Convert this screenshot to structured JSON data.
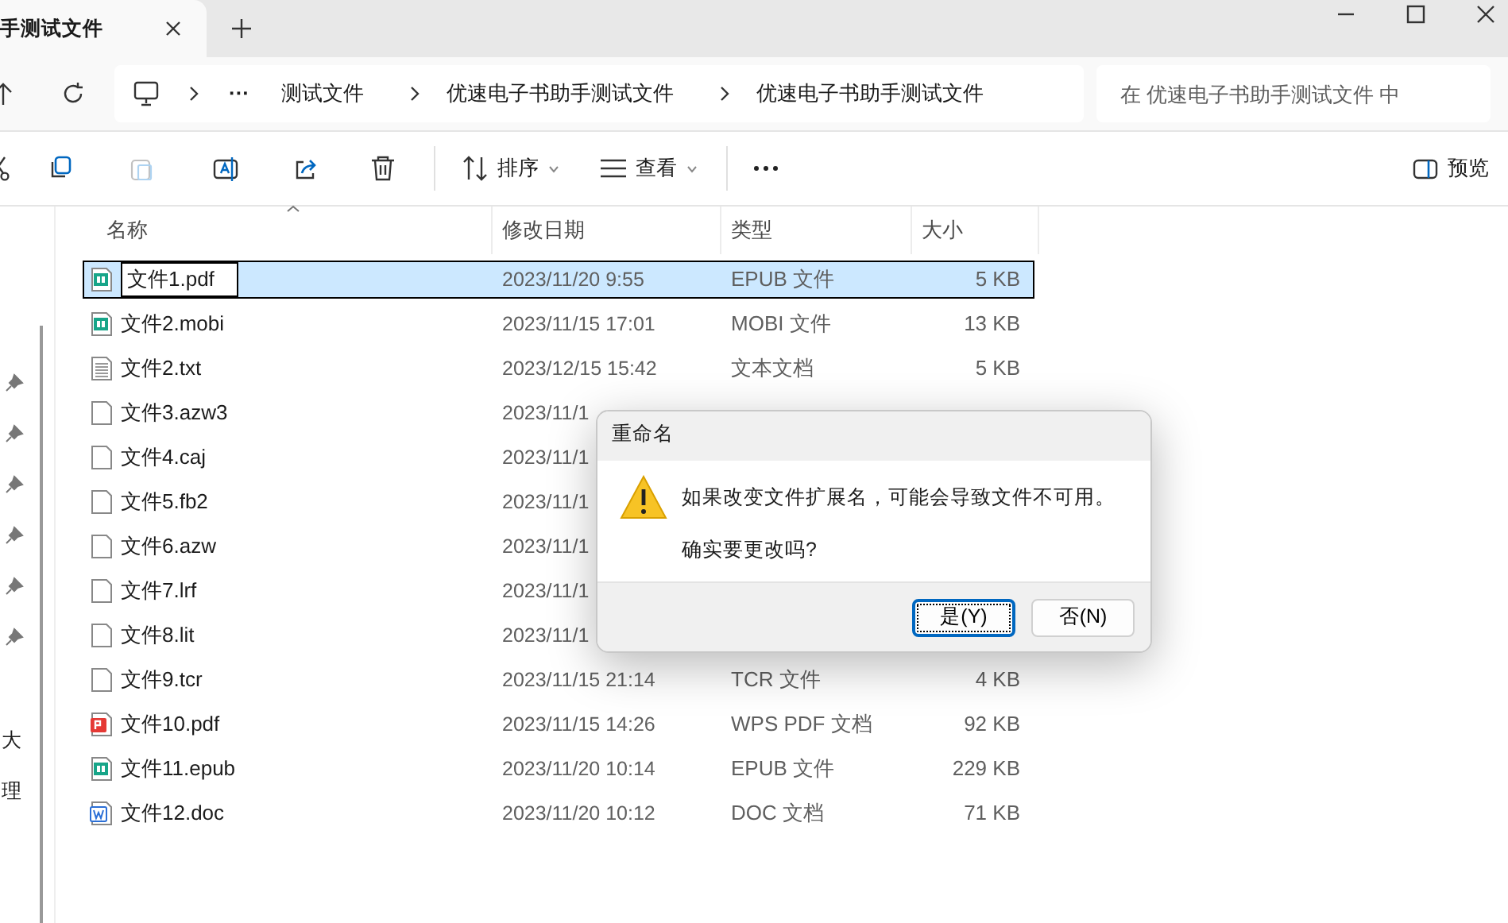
{
  "tab": {
    "title": "手测试文件"
  },
  "address": {
    "overflow": "···",
    "crumbs": [
      "测试文件",
      "优速电子书助手测试文件",
      "优速电子书助手测试文件"
    ]
  },
  "search": {
    "placeholder": "在 优速电子书助手测试文件 中"
  },
  "toolbar": [
    {
      "kind": "cut",
      "disabled": false
    },
    {
      "kind": "copy",
      "disabled": false
    },
    {
      "kind": "paste",
      "disabled": true
    },
    {
      "kind": "rename",
      "disabled": false
    },
    {
      "kind": "share",
      "disabled": false
    },
    {
      "kind": "delete",
      "disabled": false
    },
    {
      "kind": "sort",
      "label": "排序"
    },
    {
      "kind": "view",
      "label": "查看"
    },
    {
      "kind": "more"
    }
  ],
  "preview": {
    "label": "预览"
  },
  "sidebar": {
    "items": [
      {
        "pinned": true
      },
      {
        "pinned": true
      },
      {
        "pinned": true
      },
      {
        "pinned": true
      },
      {
        "pinned": true
      },
      {
        "pinned": true
      },
      {
        "label": "大"
      },
      {
        "label": "理"
      }
    ]
  },
  "table": {
    "columns": [
      "名称",
      "修改日期",
      "类型",
      "大小"
    ],
    "rows": [
      {
        "kind": "epub",
        "name": "文件1.pdf",
        "date": "2023/11/20 9:55",
        "type": "EPUB 文件",
        "size": "5 KB",
        "selected": true,
        "editing": true
      },
      {
        "kind": "epub",
        "name": "文件2.mobi",
        "date": "2023/11/15 17:01",
        "type": "MOBI 文件",
        "size": "13 KB",
        "selected": false,
        "editing": false
      },
      {
        "kind": "text",
        "name": "文件2.txt",
        "date": "2023/12/15 15:42",
        "type": "文本文档",
        "size": "5 KB",
        "selected": false,
        "editing": false
      },
      {
        "kind": "blank",
        "name": "文件3.azw3",
        "date": "2023/11/1",
        "selected": false,
        "editing": false
      },
      {
        "kind": "blank",
        "name": "文件4.caj",
        "date": "2023/11/1",
        "selected": false,
        "editing": false
      },
      {
        "kind": "blank",
        "name": "文件5.fb2",
        "date": "2023/11/1",
        "selected": false,
        "editing": false
      },
      {
        "kind": "blank",
        "name": "文件6.azw",
        "date": "2023/11/1",
        "selected": false,
        "editing": false
      },
      {
        "kind": "blank",
        "name": "文件7.lrf",
        "date": "2023/11/1",
        "selected": false,
        "editing": false
      },
      {
        "kind": "blank",
        "name": "文件8.lit",
        "date": "2023/11/1",
        "selected": false,
        "editing": false
      },
      {
        "kind": "blank",
        "name": "文件9.tcr",
        "date": "2023/11/15 21:14",
        "type": "TCR 文件",
        "size": "4 KB",
        "selected": false,
        "editing": false
      },
      {
        "kind": "pdf",
        "name": "文件10.pdf",
        "date": "2023/11/15 14:26",
        "type": "WPS PDF 文档",
        "size": "92 KB",
        "selected": false,
        "editing": false
      },
      {
        "kind": "epub",
        "name": "文件11.epub",
        "date": "2023/11/20 10:14",
        "type": "EPUB 文件",
        "size": "229 KB",
        "selected": false,
        "editing": false
      },
      {
        "kind": "doc",
        "name": "文件12.doc",
        "date": "2023/11/20 10:12",
        "type": "DOC 文档",
        "size": "71 KB",
        "selected": false,
        "editing": false
      }
    ]
  },
  "dialog": {
    "title": "重命名",
    "message": "如果改变文件扩展名，可能会导致文件不可用。",
    "question": "确实要更改吗?",
    "buttons": [
      {
        "label": "是(Y)",
        "default": true
      },
      {
        "label": "否(N)",
        "default": false
      }
    ]
  }
}
